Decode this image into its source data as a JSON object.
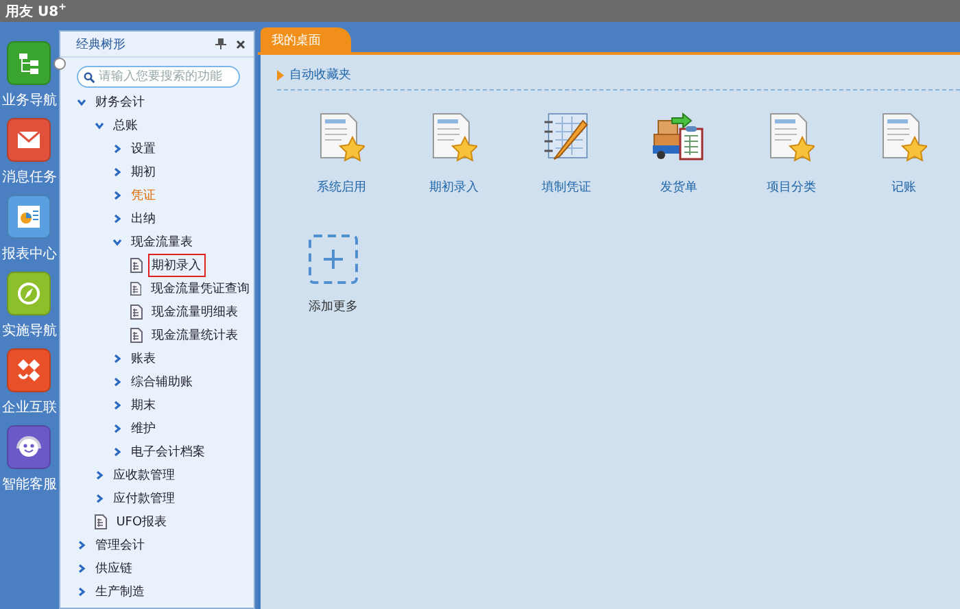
{
  "window": {
    "title": "用友 U8$^{+}$"
  },
  "nav": [
    {
      "label": "业务导航",
      "kind": "tree",
      "dropdown": true
    },
    {
      "label": "消息任务",
      "kind": "message",
      "dropdown": false
    },
    {
      "label": "报表中心",
      "kind": "report",
      "dropdown": false
    },
    {
      "label": "实施导航",
      "kind": "compass",
      "dropdown": false
    },
    {
      "label": "企业互联",
      "kind": "connect",
      "dropdown": false
    },
    {
      "label": "智能客服",
      "kind": "service",
      "dropdown": false
    }
  ],
  "tree_panel": {
    "title": "经典树形",
    "search": {
      "placeholder": "请输入您要搜索的功能"
    },
    "items": [
      {
        "label": "财务会计",
        "kind": "folder",
        "expanded": true,
        "selected": false,
        "children": [
          {
            "label": "总账",
            "kind": "folder",
            "expanded": true,
            "selected": false,
            "children": [
              {
                "label": "设置",
                "kind": "folder",
                "expanded": false,
                "selected": false
              },
              {
                "label": "期初",
                "kind": "folder",
                "expanded": false,
                "selected": false
              },
              {
                "label": "凭证",
                "kind": "folder",
                "expanded": false,
                "selected": false,
                "highlighted": true
              },
              {
                "label": "出纳",
                "kind": "folder",
                "expanded": false,
                "selected": false
              },
              {
                "label": "现金流量表",
                "kind": "folder",
                "expanded": true,
                "selected": false,
                "children": [
                  {
                    "label": "期初录入",
                    "kind": "doc",
                    "selected": true
                  },
                  {
                    "label": "现金流量凭证查询",
                    "kind": "doc",
                    "selected": false
                  },
                  {
                    "label": "现金流量明细表",
                    "kind": "doc",
                    "selected": false
                  },
                  {
                    "label": "现金流量统计表",
                    "kind": "doc",
                    "selected": false
                  }
                ]
              },
              {
                "label": "账表",
                "kind": "folder",
                "expanded": false,
                "selected": false
              },
              {
                "label": "综合辅助账",
                "kind": "folder",
                "expanded": false,
                "selected": false
              },
              {
                "label": "期末",
                "kind": "folder",
                "expanded": false,
                "selected": false
              },
              {
                "label": "维护",
                "kind": "folder",
                "expanded": false,
                "selected": false
              },
              {
                "label": "电子会计档案",
                "kind": "folder",
                "expanded": false,
                "selected": false
              }
            ]
          },
          {
            "label": "应收款管理",
            "kind": "folder",
            "expanded": false,
            "selected": false
          },
          {
            "label": "应付款管理",
            "kind": "folder",
            "expanded": false,
            "selected": false
          },
          {
            "label": "UFO报表",
            "kind": "doc",
            "selected": false
          }
        ]
      },
      {
        "label": "管理会计",
        "kind": "folder",
        "expanded": false,
        "selected": false
      },
      {
        "label": "供应链",
        "kind": "folder",
        "expanded": false,
        "selected": false
      },
      {
        "label": "生产制造",
        "kind": "folder",
        "expanded": false,
        "selected": false
      }
    ]
  },
  "tabs": [
    {
      "label": "我的桌面",
      "selected": true
    }
  ],
  "favorites": {
    "title": "自动收藏夹",
    "items": [
      {
        "label": "系统启用",
        "kind": "doc-star"
      },
      {
        "label": "期初录入",
        "kind": "doc-star"
      },
      {
        "label": "填制凭证",
        "kind": "notebook"
      },
      {
        "label": "发货单",
        "kind": "delivery"
      },
      {
        "label": "项目分类",
        "kind": "doc-star"
      },
      {
        "label": "记账",
        "kind": "doc-star"
      }
    ],
    "add_label": "添加更多"
  }
}
